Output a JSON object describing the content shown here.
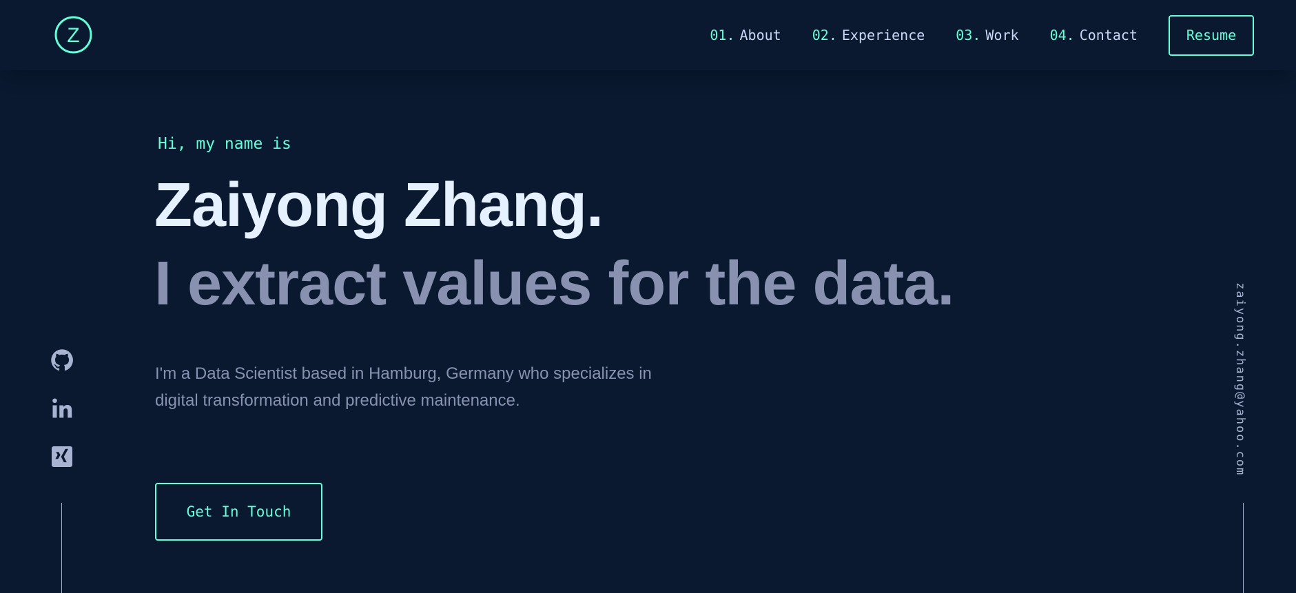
{
  "colors": {
    "background": "#0a192f",
    "accent": "#64ffda",
    "heading": "#e6f1ff",
    "text": "#8892b0",
    "light_text": "#ccd6f6"
  },
  "header": {
    "logo_letter": "Z",
    "logo_icon": "z-logo-icon",
    "nav": [
      {
        "num": "01.",
        "label": "About"
      },
      {
        "num": "02.",
        "label": "Experience"
      },
      {
        "num": "03.",
        "label": "Work"
      },
      {
        "num": "04.",
        "label": "Contact"
      }
    ],
    "resume_label": "Resume"
  },
  "hero": {
    "greeting": "Hi, my name is",
    "name": "Zaiyong Zhang.",
    "tagline": "I extract values for the data.",
    "bio": "I'm a Data Scientist based in Hamburg, Germany who specializes in digital transformation and predictive maintenance.",
    "cta_label": "Get In Touch"
  },
  "social": {
    "icons": [
      "github-icon",
      "linkedin-icon",
      "xing-icon"
    ]
  },
  "side_email": "zaiyong.zhang@yahoo.com"
}
